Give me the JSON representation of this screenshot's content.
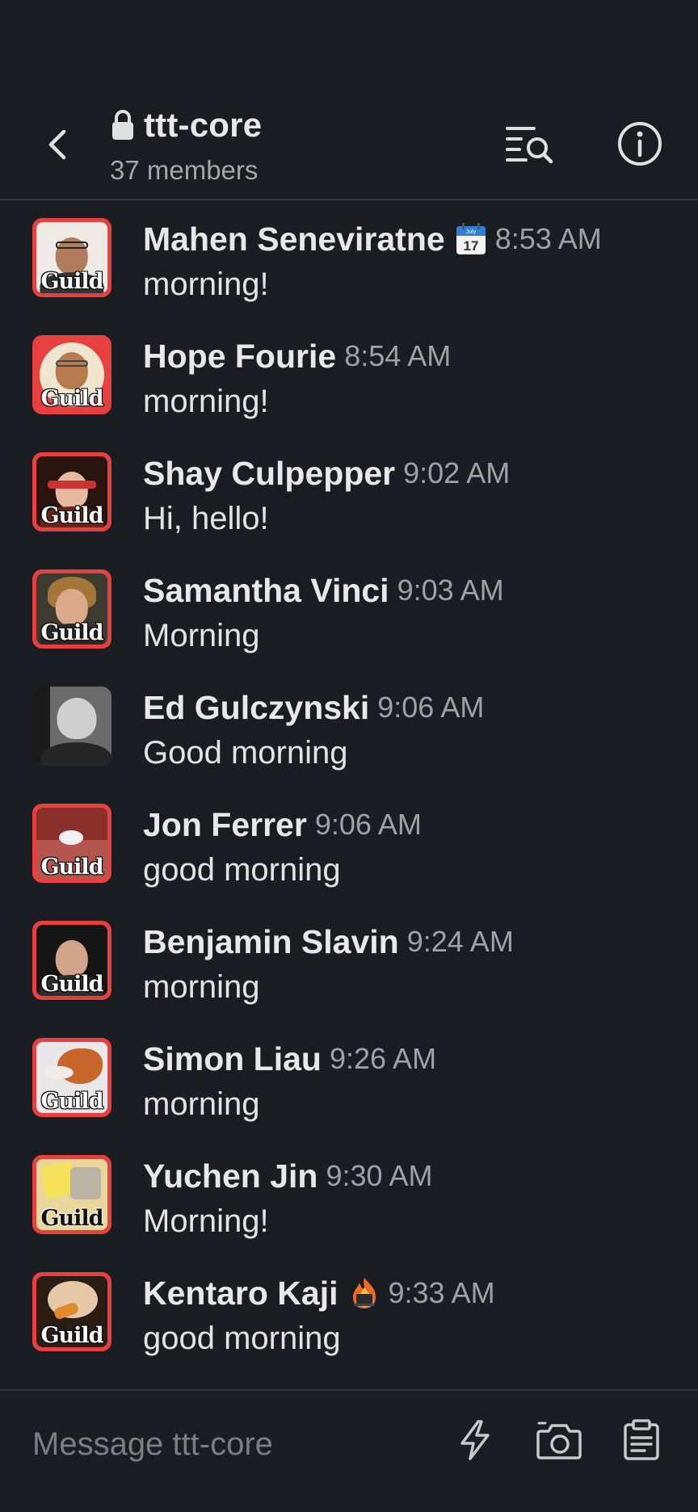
{
  "header": {
    "back_icon": "chevron-left-icon",
    "lock_icon": "lock-icon",
    "channel_name": "ttt-core",
    "members": "37 members",
    "search_icon": "search-list-icon",
    "info_icon": "info-icon"
  },
  "messages": [
    {
      "author": "Mahen Seneviratne",
      "status_icon": "calendar-icon",
      "time": "8:53 AM",
      "text": "morning!",
      "avatar_badge": "Guild"
    },
    {
      "author": "Hope Fourie",
      "status_icon": "",
      "time": "8:54 AM",
      "text": "morning!",
      "avatar_badge": "Guild"
    },
    {
      "author": "Shay Culpepper",
      "status_icon": "",
      "time": "9:02 AM",
      "text": "Hi, hello!",
      "avatar_badge": "Guild"
    },
    {
      "author": "Samantha Vinci",
      "status_icon": "",
      "time": "9:03 AM",
      "text": "Morning",
      "avatar_badge": "Guild"
    },
    {
      "author": "Ed Gulczynski",
      "status_icon": "",
      "time": "9:06 AM",
      "text": "Good morning",
      "avatar_badge": ""
    },
    {
      "author": "Jon Ferrer",
      "status_icon": "",
      "time": "9:06 AM",
      "text": "good morning",
      "avatar_badge": "Guild"
    },
    {
      "author": "Benjamin Slavin",
      "status_icon": "",
      "time": "9:24 AM",
      "text": "morning",
      "avatar_badge": "Guild"
    },
    {
      "author": "Simon Liau",
      "status_icon": "",
      "time": "9:26 AM",
      "text": "morning",
      "avatar_badge": "Guild"
    },
    {
      "author": "Yuchen Jin",
      "status_icon": "",
      "time": "9:30 AM",
      "text": "Morning!",
      "avatar_badge": "Guild"
    },
    {
      "author": "Kentaro Kaji",
      "status_icon": "laptop-fire-icon",
      "time": "9:33 AM",
      "text": "good morning",
      "avatar_badge": "Guild"
    }
  ],
  "calendar_day": "17",
  "calendar_month": "July",
  "composer": {
    "placeholder": "Message ttt-core",
    "shortcut_icon": "lightning-icon",
    "camera_icon": "camera-icon",
    "canvas_icon": "clipboard-list-icon"
  },
  "colors": {
    "background": "#1a1d21",
    "avatar_frame": "#e8403f",
    "text_primary": "#e8e8e8",
    "text_secondary": "#a0a1a4"
  }
}
